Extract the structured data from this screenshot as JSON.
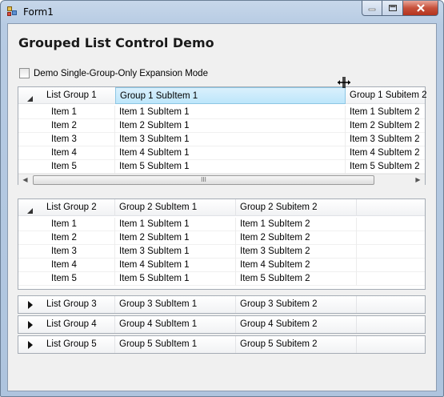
{
  "window": {
    "title": "Form1"
  },
  "heading": "Grouped List Control Demo",
  "option": {
    "label": "Demo Single-Group-Only Expansion Mode",
    "checked": false
  },
  "scrollbar": {
    "thumb_glyph": "III"
  },
  "groups": [
    {
      "name": "List Group 1",
      "col2": "Group 1 SubItem 1",
      "col3": "Group 1 Subitem 2",
      "expanded": true,
      "items": [
        [
          "Item 1",
          "Item 1 SubItem 1",
          "Item 1 SubItem 2"
        ],
        [
          "Item 2",
          "Item 2 SubItem 1",
          "Item 2 SubItem 2"
        ],
        [
          "Item 3",
          "Item 3 SubItem 1",
          "Item 3 SubItem 2"
        ],
        [
          "Item 4",
          "Item 4 SubItem 1",
          "Item 4 SubItem 2"
        ],
        [
          "Item 5",
          "Item 5 SubItem 1",
          "Item 5 SubItem 2"
        ]
      ]
    },
    {
      "name": "List Group 2",
      "col2": "Group 2 SubItem 1",
      "col3": "Group 2 Subitem 2",
      "expanded": true,
      "items": [
        [
          "Item 1",
          "Item 1 SubItem 1",
          "Item 1 SubItem 2"
        ],
        [
          "Item 2",
          "Item 2 SubItem 1",
          "Item 2 SubItem 2"
        ],
        [
          "Item 3",
          "Item 3 SubItem 1",
          "Item 3 SubItem 2"
        ],
        [
          "Item 4",
          "Item 4 SubItem 1",
          "Item 4 SubItem 2"
        ],
        [
          "Item 5",
          "Item 5 SubItem 1",
          "Item 5 SubItem 2"
        ]
      ]
    },
    {
      "name": "List Group 3",
      "col2": "Group 3 SubItem 1",
      "col3": "Group 3 Subitem 2",
      "expanded": false,
      "items": []
    },
    {
      "name": "List Group 4",
      "col2": "Group 4 SubItem 1",
      "col3": "Group 4 Subitem 2",
      "expanded": false,
      "items": []
    },
    {
      "name": "List Group 5",
      "col2": "Group 5 SubItem 1",
      "col3": "Group 5 Subitem 2",
      "expanded": false,
      "items": []
    }
  ]
}
